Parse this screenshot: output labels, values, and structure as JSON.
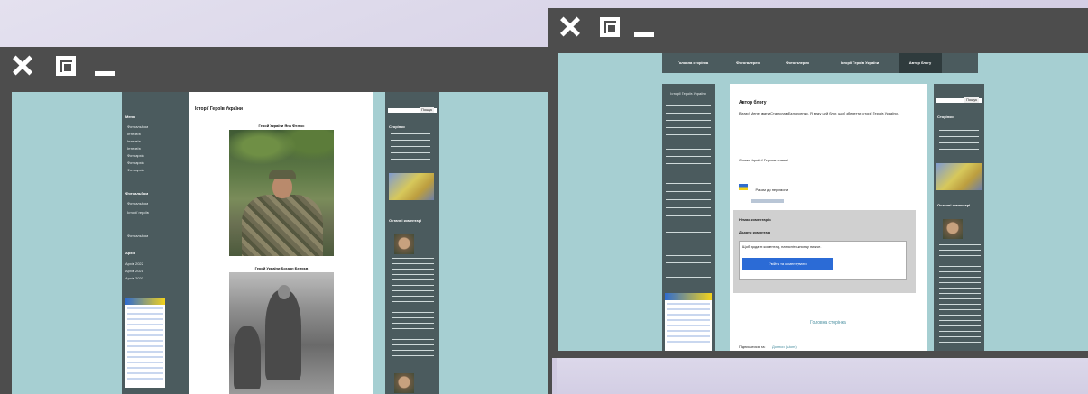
{
  "window_controls": {
    "close": "close",
    "maximize": "maximize",
    "minimize": "minimize"
  },
  "left_window": {
    "page_title": "Історії Героїв України",
    "photo1_caption": "Герой України Яна Фелікс",
    "photo2_caption": "Герой України Богдан Беляєв",
    "sidebar_heading_1": "Меню",
    "sidebar_items_1": [
      "Фотоальбом",
      "Інтерв'ю",
      "Інтерв'ю",
      "Інтерв'ю",
      "Фотоархів",
      "Фотоархів",
      "Фотоархів"
    ],
    "sidebar_heading_2": "Фотоальбом",
    "sidebar_items_2": [
      "Фотоальбом",
      "Історії героїв",
      "Фотоальбом"
    ],
    "sidebar_heading_3": "Архів",
    "sidebar_items_3": [
      "Архів 2022",
      "Архів 2021",
      "Архів 2020"
    ],
    "right_search_label": "Пошук",
    "right_heading_1": "Сторінки",
    "right_heading_2": "Останні коментарі"
  },
  "right_window": {
    "nav": [
      "Головна сторінка",
      "Фотогалерея",
      "Фотогалерея",
      "Історії Героїв України",
      "Автор блогу"
    ],
    "left_sidebar_title": "Історії Героїв України",
    "article_title": "Автор блогу",
    "paragraph_1": "Вітаю! Мене звати Станіслав Бєлоусенко. Я веду цей блог, щоб зберегти історії Героїв України.",
    "paragraph_2": "Слава Україні! Героям слава!",
    "flag_label": "Разом до перемоги",
    "comment_box_title": "Немає коментарів",
    "comment_box_subtitle": "Додати коментар",
    "comment_box_text": "Щоб додати коментар, натисніть кнопку нижче.",
    "comment_button": "Увійти та коментувати",
    "home_link": "Головна сторінка",
    "subscribe_label": "Підписатися на:",
    "subscribe_link": "Дописи (Atom)",
    "right_search_label": "Пошук",
    "right_heading_1": "Сторінки",
    "right_heading_2": "Останні коментарі"
  }
}
